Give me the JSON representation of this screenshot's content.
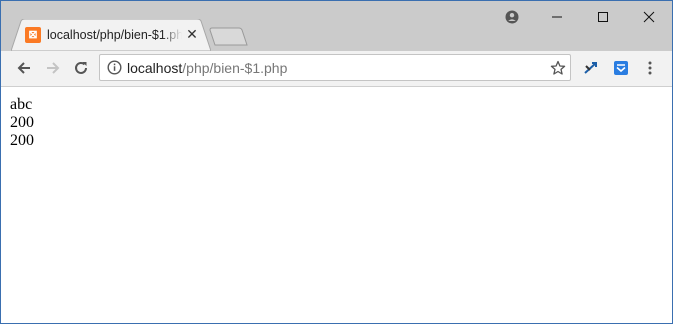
{
  "browser": {
    "tab": {
      "title": "localhost/php/bien-$1.php",
      "favicon": "xampp-icon"
    },
    "address": {
      "host": "localhost",
      "path": "/php/bien-$1.php"
    },
    "colors": {
      "titlebar": "#cbcbcb",
      "toolbar": "#f2f2f2",
      "favicon": "#fb7a24",
      "border": "#3a6fb0"
    }
  },
  "page": {
    "lines": [
      "abc",
      "200",
      "200"
    ]
  }
}
